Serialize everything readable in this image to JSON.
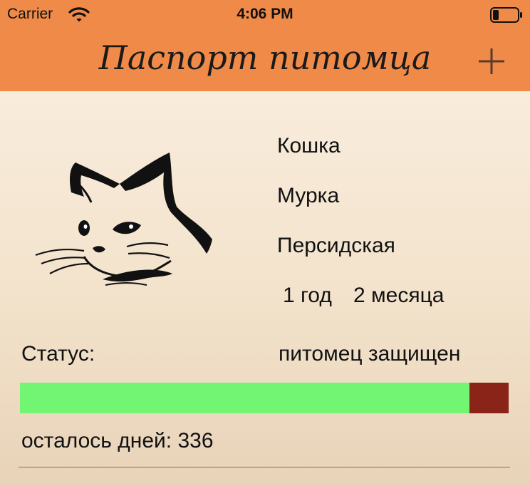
{
  "status_bar": {
    "carrier": "Carrier",
    "time": "4:06 PM"
  },
  "nav": {
    "title": "Паспорт питомца",
    "add_icon": "plus-icon"
  },
  "pet": {
    "image_icon": "cat-head-icon",
    "type": "Кошка",
    "name": "Мурка",
    "breed": "Персидская",
    "age_years": "1 год",
    "age_months": "2 месяца"
  },
  "protection": {
    "status_label": "Статус:",
    "status_value": "питомец защищен",
    "days_label": "осталось дней:",
    "days_value": "336",
    "progress_fraction": 0.92,
    "fill_color": "#72f573",
    "remaining_color": "#8b2418"
  },
  "colors": {
    "nav_bg": "#ef8a48"
  }
}
